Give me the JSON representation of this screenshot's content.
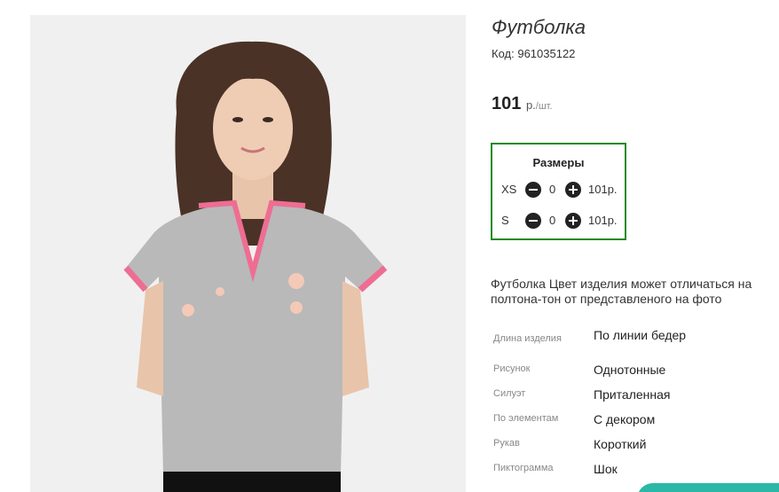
{
  "product": {
    "title": "Футболка",
    "code_label": "Код:",
    "code_value": "961035122",
    "price_value": "101",
    "price_currency": "р.",
    "price_per": "/шт.",
    "image_alt": "product-photo"
  },
  "sizes": {
    "heading": "Размеры",
    "rows": [
      {
        "size": "XS",
        "qty": "0",
        "price": "101р."
      },
      {
        "size": "S",
        "qty": "0",
        "price": "101р."
      }
    ]
  },
  "description": "Футболка Цвет изделия может отличаться на полтона-тон от представленого на фото",
  "properties": [
    {
      "key": "Длина изделия",
      "value": "По линии бедер"
    },
    {
      "key": "Рисунок",
      "value": "Однотонные"
    },
    {
      "key": "Силуэт",
      "value": "Приталенная"
    },
    {
      "key": "По элементам",
      "value": "С декором"
    },
    {
      "key": "Рукав",
      "value": "Короткий"
    },
    {
      "key": "Пиктограмма",
      "value": "Шок"
    }
  ],
  "colors": {
    "accent_border": "#1e8a1e",
    "tab": "#2bb8a6"
  },
  "icons": {
    "minus": "minus-circle-icon",
    "plus": "plus-circle-icon"
  }
}
